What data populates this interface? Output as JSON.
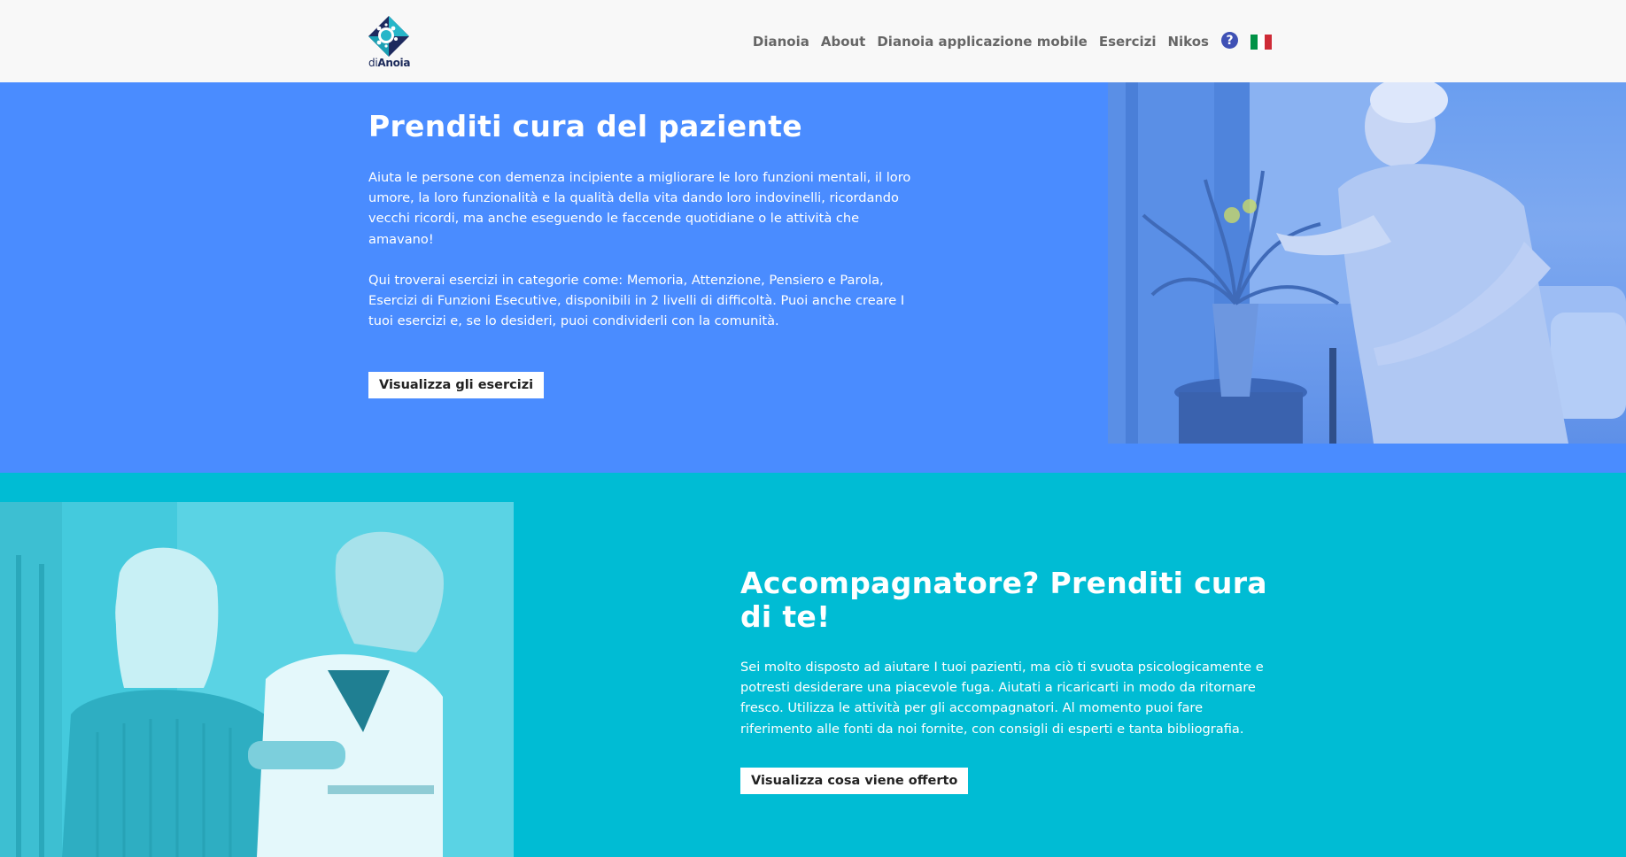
{
  "header": {
    "logo": {
      "text_prefix": "di",
      "text_bold": "Anoia"
    },
    "nav": [
      {
        "label": "Dianoia"
      },
      {
        "label": "About"
      },
      {
        "label": "Dianoia applicazione mobile"
      },
      {
        "label": "Esercizi"
      },
      {
        "label": "Nikos"
      }
    ],
    "help_icon": {
      "glyph": "?",
      "icon": "help-circle-icon"
    },
    "language_icon": {
      "icon": "italian-flag-icon"
    }
  },
  "patient_section": {
    "title": "Prenditi cura del paziente",
    "paragraph_1": "Aiuta le persone con demenza incipiente a migliorare le loro funzioni mentali, il loro umore, la loro funzionalità e la qualità della vita dando loro indovinelli, ricordando vecchi ricordi, ma anche eseguendo le faccende quotidiane o le attività che amavano!",
    "paragraph_2": "Qui troverai esercizi in categorie come: Memoria, Attenzione, Pensiero e Parola, Esercizi di Funzioni Esecutive, disponibili in 2 livelli di difficoltà. Puoi anche creare I tuoi esercizi e, se lo desideri, puoi condividerli con la comunità.",
    "button_label": "Visualizza gli esercizi"
  },
  "caregiver_section": {
    "title": "Accompagnatore? Prenditi cura di te!",
    "paragraph": "Sei molto disposto ad aiutare I tuoi pazienti, ma ciò ti svuota psicologicamente e potresti desiderare una piacevole fuga. Aiutati a ricaricarti in modo da ritornare fresco. Utilizza le attività per gli accompagnatori. Al momento puoi fare riferimento alle fonti da noi fornite, con consigli di esperti e tanta bibliografia.",
    "button_label": "Visualizza cosa viene offerto"
  },
  "colors": {
    "header_bg": "#f8f8f8",
    "patient_bg": "#4a8cff",
    "caregiver_bg": "#00bcd4",
    "nav_text": "#666666",
    "help_icon_bg": "#3f51b5"
  }
}
